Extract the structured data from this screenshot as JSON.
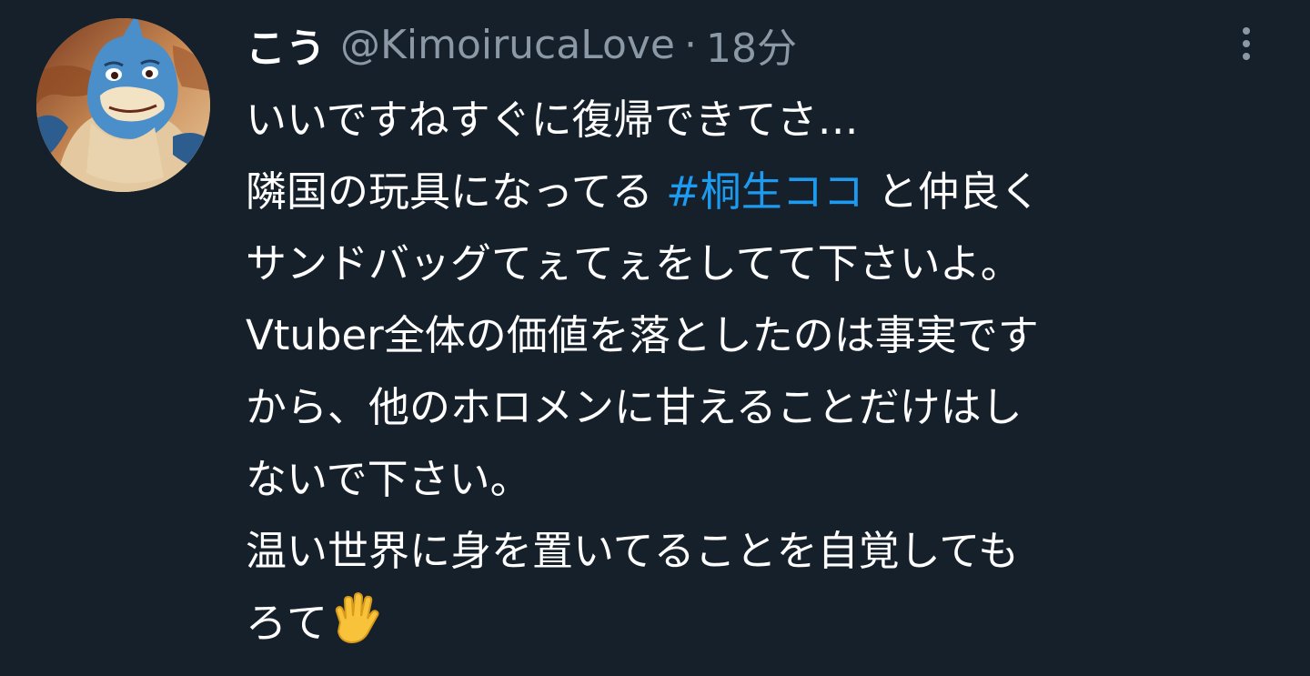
{
  "author": {
    "name": "こう",
    "handle": "@KimoirucaLove",
    "separator": "·",
    "time": "18分",
    "avatar_icon": "avatar-character-icon"
  },
  "menu": {
    "icon": "more-vertical-icon"
  },
  "tweet": {
    "line1": "いいですねすぐに復帰できてさ…",
    "line2_before": "隣国の玩具になってる ",
    "hashtag": "#桐生ココ",
    "line2_after": " と仲良く",
    "line3": "サンドバッグてぇてぇをしてて下さいよ。",
    "line4": "Vtuber全体の価値を落としたのは事実です",
    "line5": "から、他のホロメンに甘えることだけはし",
    "line6": "ないで下さい。",
    "line7": "温い世界に身を置いてることを自覚しても",
    "line8": "ろて",
    "emoji": "raised-hand-icon"
  },
  "colors": {
    "background": "#15202b",
    "text": "#ffffff",
    "secondary": "#8b98a5",
    "link": "#1d9bf0"
  }
}
